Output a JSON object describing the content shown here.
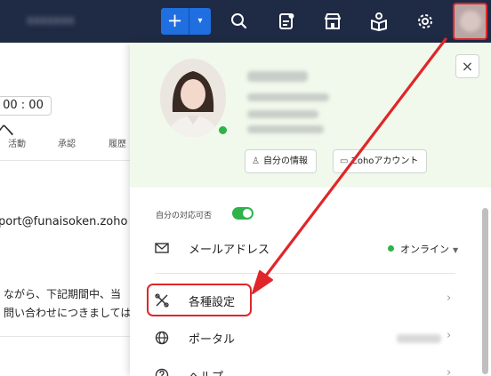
{
  "topbar": {
    "org_name": "xxxxxxx",
    "add_label": "+",
    "add_caret": "▾"
  },
  "background": {
    "time_value": "00 : 00",
    "tabs": [
      "活動",
      "承認",
      "履歴"
    ],
    "email_text": "port@funaisoken.zoho",
    "body_lines": [
      "ながら、下記期間中、当",
      "問い合わせにつきましては、"
    ]
  },
  "profile": {
    "my_info_label": "自分の情報",
    "zoho_account_label": "Zohoアカウント",
    "close_label": "×"
  },
  "availability": {
    "label": "自分の対応可否",
    "enabled": true
  },
  "menu": {
    "mail_label": "メールアドレス",
    "online_label": "オンライン",
    "settings_label": "各種設定",
    "portal_label": "ポータル",
    "help_label": "ヘルプ"
  },
  "colors": {
    "topbar": "#1f2a44",
    "accent_blue": "#1f6fe0",
    "highlight_red": "#e0262a",
    "online_green": "#2db34a",
    "profile_bg": "#f1f9ec"
  }
}
